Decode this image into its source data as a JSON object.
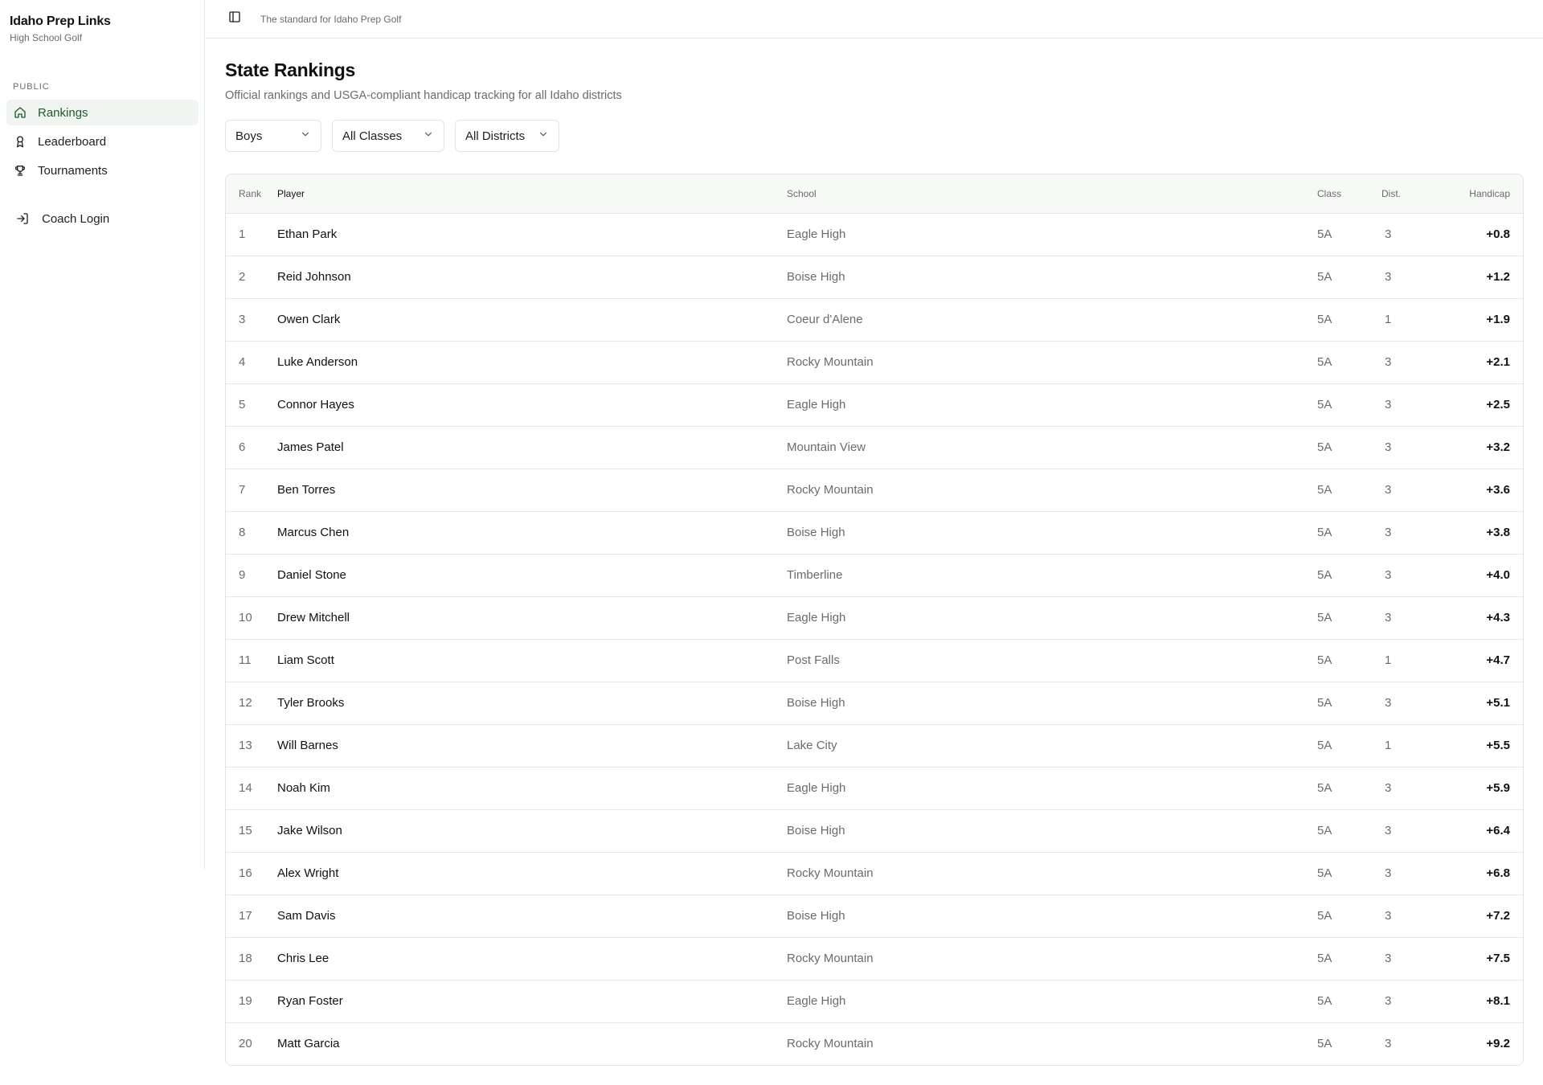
{
  "app": {
    "title": "Idaho Prep Links",
    "subtitle": "High School Golf"
  },
  "sidebar": {
    "group_label": "PUBLIC",
    "items": [
      {
        "label": "Rankings",
        "icon": "home-icon",
        "active": true
      },
      {
        "label": "Leaderboard",
        "icon": "award-icon",
        "active": false
      },
      {
        "label": "Tournaments",
        "icon": "trophy-icon",
        "active": false
      }
    ],
    "coach_login": {
      "label": "Coach Login",
      "icon": "login-icon"
    }
  },
  "topbar": {
    "tagline": "The standard for Idaho Prep Golf"
  },
  "page": {
    "title": "State Rankings",
    "subtitle": "Official rankings and USGA-compliant handicap tracking for all Idaho districts"
  },
  "filters": {
    "gender": "Boys",
    "class": "All Classes",
    "district": "All Districts"
  },
  "table": {
    "columns": {
      "rank": "Rank",
      "player": "Player",
      "school": "School",
      "class": "Class",
      "dist": "Dist.",
      "handicap": "Handicap"
    },
    "rows": [
      {
        "rank": "1",
        "player": "Ethan Park",
        "school": "Eagle High",
        "class": "5A",
        "dist": "3",
        "handicap": "+0.8"
      },
      {
        "rank": "2",
        "player": "Reid Johnson",
        "school": "Boise High",
        "class": "5A",
        "dist": "3",
        "handicap": "+1.2"
      },
      {
        "rank": "3",
        "player": "Owen Clark",
        "school": "Coeur d'Alene",
        "class": "5A",
        "dist": "1",
        "handicap": "+1.9"
      },
      {
        "rank": "4",
        "player": "Luke Anderson",
        "school": "Rocky Mountain",
        "class": "5A",
        "dist": "3",
        "handicap": "+2.1"
      },
      {
        "rank": "5",
        "player": "Connor Hayes",
        "school": "Eagle High",
        "class": "5A",
        "dist": "3",
        "handicap": "+2.5"
      },
      {
        "rank": "6",
        "player": "James Patel",
        "school": "Mountain View",
        "class": "5A",
        "dist": "3",
        "handicap": "+3.2"
      },
      {
        "rank": "7",
        "player": "Ben Torres",
        "school": "Rocky Mountain",
        "class": "5A",
        "dist": "3",
        "handicap": "+3.6"
      },
      {
        "rank": "8",
        "player": "Marcus Chen",
        "school": "Boise High",
        "class": "5A",
        "dist": "3",
        "handicap": "+3.8"
      },
      {
        "rank": "9",
        "player": "Daniel Stone",
        "school": "Timberline",
        "class": "5A",
        "dist": "3",
        "handicap": "+4.0"
      },
      {
        "rank": "10",
        "player": "Drew Mitchell",
        "school": "Eagle High",
        "class": "5A",
        "dist": "3",
        "handicap": "+4.3"
      },
      {
        "rank": "11",
        "player": "Liam Scott",
        "school": "Post Falls",
        "class": "5A",
        "dist": "1",
        "handicap": "+4.7"
      },
      {
        "rank": "12",
        "player": "Tyler Brooks",
        "school": "Boise High",
        "class": "5A",
        "dist": "3",
        "handicap": "+5.1"
      },
      {
        "rank": "13",
        "player": "Will Barnes",
        "school": "Lake City",
        "class": "5A",
        "dist": "1",
        "handicap": "+5.5"
      },
      {
        "rank": "14",
        "player": "Noah Kim",
        "school": "Eagle High",
        "class": "5A",
        "dist": "3",
        "handicap": "+5.9"
      },
      {
        "rank": "15",
        "player": "Jake Wilson",
        "school": "Boise High",
        "class": "5A",
        "dist": "3",
        "handicap": "+6.4"
      },
      {
        "rank": "16",
        "player": "Alex Wright",
        "school": "Rocky Mountain",
        "class": "5A",
        "dist": "3",
        "handicap": "+6.8"
      },
      {
        "rank": "17",
        "player": "Sam Davis",
        "school": "Boise High",
        "class": "5A",
        "dist": "3",
        "handicap": "+7.2"
      },
      {
        "rank": "18",
        "player": "Chris Lee",
        "school": "Rocky Mountain",
        "class": "5A",
        "dist": "3",
        "handicap": "+7.5"
      },
      {
        "rank": "19",
        "player": "Ryan Foster",
        "school": "Eagle High",
        "class": "5A",
        "dist": "3",
        "handicap": "+8.1"
      },
      {
        "rank": "20",
        "player": "Matt Garcia",
        "school": "Rocky Mountain",
        "class": "5A",
        "dist": "3",
        "handicap": "+9.2"
      }
    ]
  },
  "colors": {
    "accent": "#1f5a2e",
    "active_bg": "#f1f5f1",
    "muted_text": "#6b6b6b",
    "border": "#e3e3e3"
  }
}
